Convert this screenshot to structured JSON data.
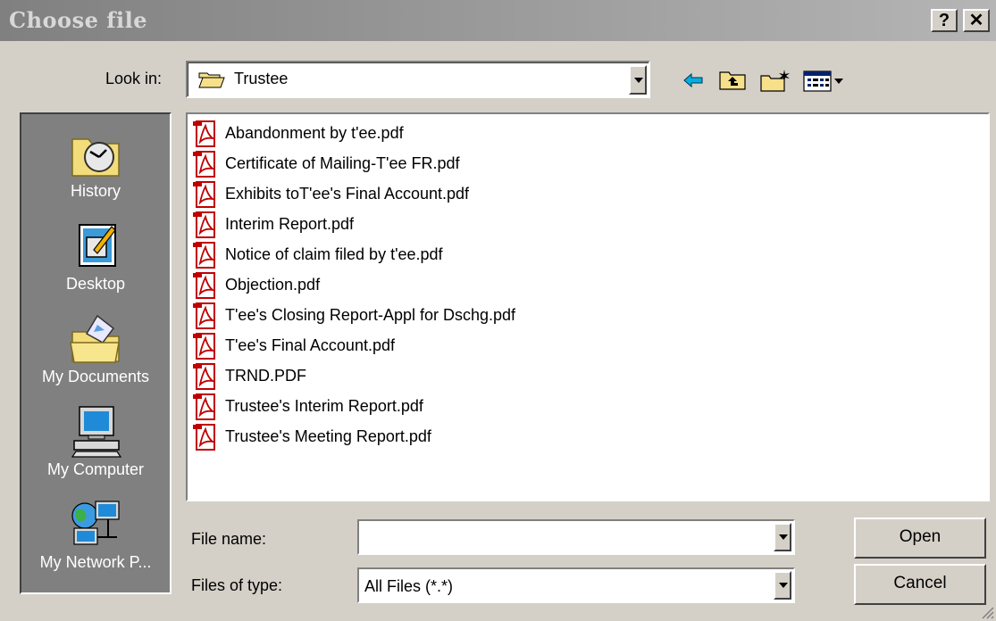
{
  "window": {
    "title": "Choose file",
    "help_label": "?",
    "close_label": "✕"
  },
  "lookin": {
    "label": "Look in:",
    "value": "Trustee"
  },
  "toolbar": {
    "icons": [
      "back-arrow-icon",
      "up-one-level-icon",
      "new-folder-icon",
      "views-menu-icon"
    ]
  },
  "places": [
    {
      "label": "History",
      "icon": "history-icon"
    },
    {
      "label": "Desktop",
      "icon": "desktop-icon"
    },
    {
      "label": "My Documents",
      "icon": "my-documents-icon"
    },
    {
      "label": "My Computer",
      "icon": "my-computer-icon"
    },
    {
      "label": "My Network P...",
      "icon": "my-network-places-icon"
    }
  ],
  "files": [
    "Abandonment by t'ee.pdf",
    "Certificate of Mailing-T'ee FR.pdf",
    "Exhibits toT'ee's Final Account.pdf",
    "Interim Report.pdf",
    "Notice of claim filed by t'ee.pdf",
    "Objection.pdf",
    "T'ee's Closing Report-Appl for Dschg.pdf",
    "T'ee's Final Account.pdf",
    "TRND.PDF",
    "Trustee's Interim Report.pdf",
    "Trustee's Meeting Report.pdf"
  ],
  "filename": {
    "label": "File name:",
    "value": ""
  },
  "filetype": {
    "label": "Files of type:",
    "value": "All Files (*.*)"
  },
  "buttons": {
    "open": "Open",
    "cancel": "Cancel"
  },
  "colors": {
    "titlebar_start": "#808080",
    "titlebar_end": "#b5b5b5",
    "dialog": "#d4d0c8",
    "places_bg": "#808080"
  }
}
